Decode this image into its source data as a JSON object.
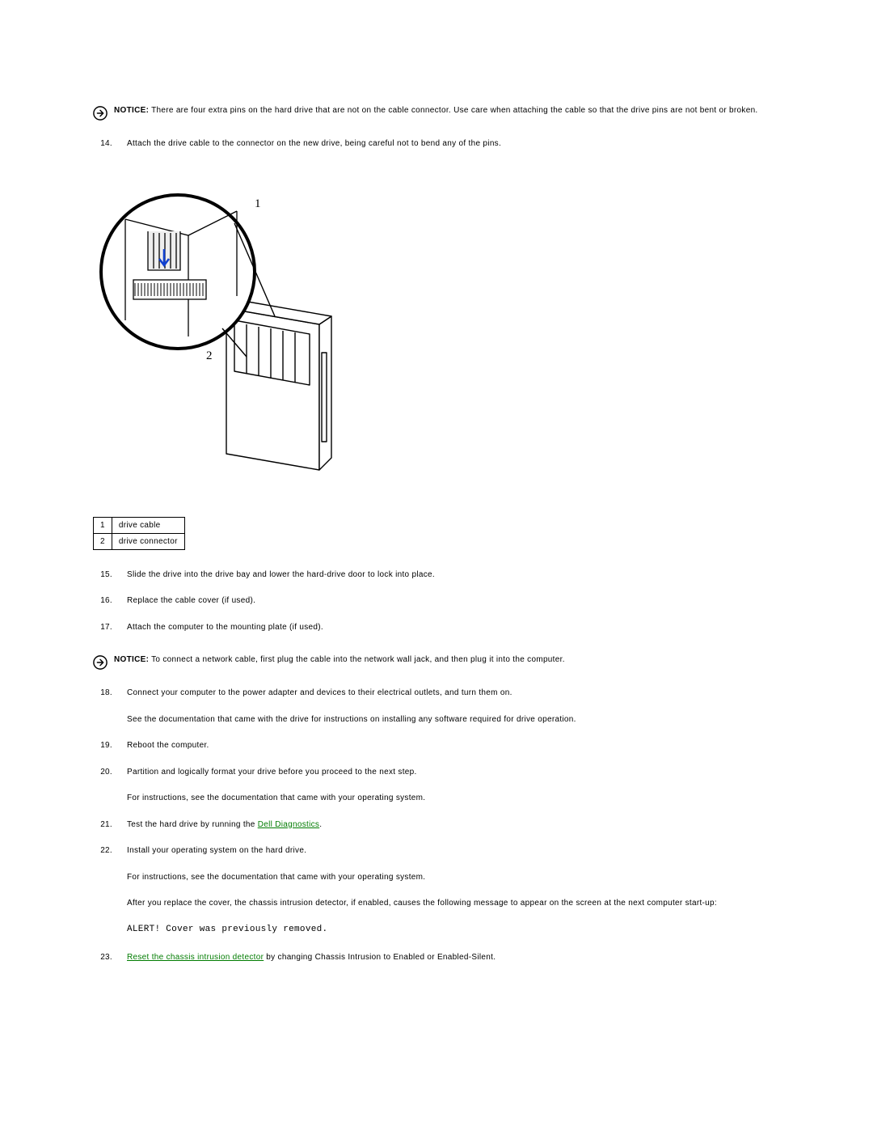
{
  "notices": {
    "pins": {
      "label": "NOTICE:",
      "text": " There are four extra pins on the hard drive that are not on the cable connector. Use care when attaching the cable so that the drive pins are not bent or broken."
    },
    "network": {
      "label": "NOTICE:",
      "text": " To connect a network cable, first plug the cable into the network wall jack, and then plug it into the computer."
    }
  },
  "callouts": {
    "r1": {
      "n": "1",
      "label": "drive cable"
    },
    "r2": {
      "n": "2",
      "label": "drive connector"
    }
  },
  "steps": {
    "s14": {
      "n": "14.",
      "t": "Attach the drive cable to the connector on the new drive, being careful not to bend any of the pins."
    },
    "s15": {
      "n": "15.",
      "t": "Slide the drive into the drive bay and lower the hard-drive door to lock into place."
    },
    "s16": {
      "n": "16.",
      "t": "Replace the cable cover (if used)."
    },
    "s17": {
      "n": "17.",
      "t": "Attach the computer to the mounting plate (if used)."
    },
    "s18": {
      "n": "18.",
      "t": "Connect your computer to the power adapter and devices to their electrical outlets, and turn them on."
    },
    "s18p": "See the documentation that came with the drive for instructions on installing any software required for drive operation.",
    "s19": {
      "n": "19.",
      "t": "Reboot the computer."
    },
    "s20": {
      "n": "20.",
      "t": "Partition and logically format your drive before you proceed to the next step."
    },
    "s20p": "For instructions, see the documentation that came with your operating system.",
    "s21": {
      "n": "21.",
      "pre": "Test the hard drive by running the ",
      "link": "Dell Diagnostics",
      "post": "."
    },
    "s22": {
      "n": "22.",
      "t": "Install your operating system on the hard drive."
    },
    "s22p": "For instructions, see the documentation that came with your operating system.",
    "s22p2": "After you replace the cover, the chassis intrusion detector, if enabled, causes the following message to appear on the screen at the next computer start-up:",
    "alert": "ALERT! Cover was previously removed.",
    "s23": {
      "n": "23.",
      "link": "Reset the chassis intrusion detector",
      "post": " by changing Chassis Intrusion to Enabled or Enabled-Silent."
    }
  },
  "figure_labels": {
    "one": "1",
    "two": "2"
  }
}
